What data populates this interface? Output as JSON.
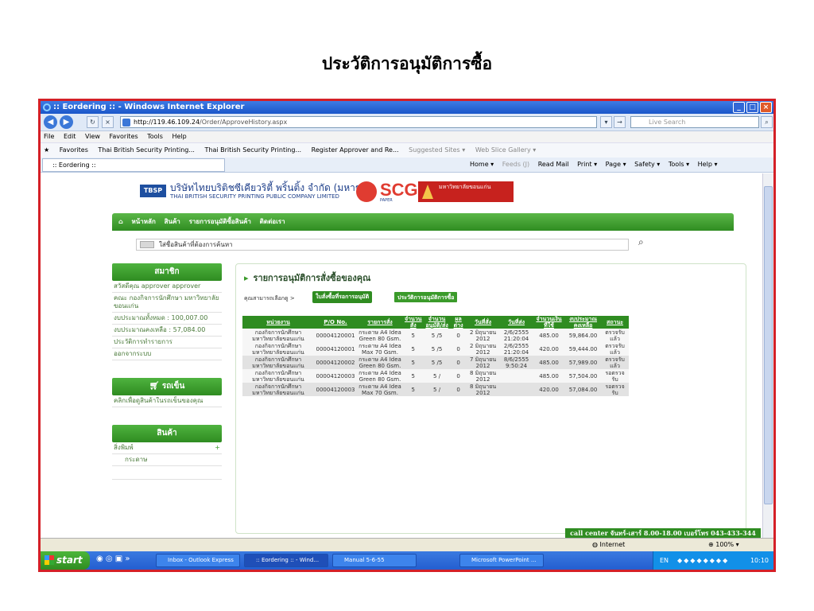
{
  "slide": {
    "title": "ประวัติการอนุมัติการซื้อ"
  },
  "window": {
    "title": ":: Eordering :: - Windows Internet Explorer"
  },
  "address": {
    "url_host": "http://119.46.109.24",
    "url_path": "/Order/ApproveHistory.aspx",
    "search_placeholder": "Live Search"
  },
  "menu": [
    "File",
    "Edit",
    "View",
    "Favorites",
    "Tools",
    "Help"
  ],
  "favorites": {
    "label": "Favorites",
    "items": [
      "Thai British Security Printing...",
      "Thai British Security Printing...",
      "Register Approver and Re...",
      "Suggested Sites ▾",
      "Web Slice Gallery ▾"
    ]
  },
  "tab": {
    "label": ":: Eordering ::"
  },
  "commands": {
    "home": "Home ▾",
    "feeds": "Feeds (J)",
    "mail": "Read Mail",
    "print": "Print ▾",
    "page": "Page ▾",
    "safety": "Safety ▾",
    "tools": "Tools ▾",
    "help": "Help ▾"
  },
  "header": {
    "logo": "TBSP",
    "company_th": "บริษัทไทยบริติชซีเคียวริตี้ พริ้นติ้ง จำกัด (มหาชน)",
    "company_en": "THAI BRITISH SECURITY PRINTING PUBLIC COMPANY LIMITED",
    "scg": "SCG",
    "scg_sub": "PAPER",
    "university": "มหาวิทยาลัยขอนแก่น"
  },
  "nav": [
    "หน้าหลัก",
    "สินค้า",
    "รายการอนุมัติซื้อสินค้า",
    "ติดต่อเรา"
  ],
  "search": {
    "placeholder": "ใส่ชื่อสินค้าที่ต้องการค้นหา"
  },
  "sidebar": {
    "member_title": "สมาชิก",
    "member_items": [
      "สวัสดีคุณ approver approver",
      "คณะ กองกิจการนักศึกษา มหาวิทยาลัยขอนแก่น",
      "งบประมาณทั้งหมด : 100,007.00",
      "งบประมาณคงเหลือ : 57,084.00",
      "ประวัติการทำรายการ",
      "ออกจากระบบ"
    ],
    "cart_title": "รถเข็น",
    "cart_items": [
      "คลิกเพื่อดูสินค้าในรถเข็นของคุณ"
    ],
    "product_title": "สินค้า",
    "product_items": [
      "สิ่งพิมพ์",
      "กระดาษ"
    ]
  },
  "panel": {
    "title": "รายการอนุมัติการสั่งซื้อของคุณ",
    "pick_label": "คุณสามารถเลือกดู >",
    "btn_pending": "ใบสั่งซื้อที่รอการอนุมัติ",
    "btn_history": "ประวัติการอนุมัติการซื้อ"
  },
  "table": {
    "headers": [
      "หน่วยงาน",
      "P/O No.",
      "รายการสั่ง",
      "จำนวนสั่ง",
      "จำนวนอนุมัติ/ส่ง",
      "ผลต่าง",
      "วันที่สั่ง",
      "วันที่ส่ง",
      "จำนวนเงินที่ใช้",
      "งบประมาณคงเหลือ",
      "สถานะ"
    ],
    "rows": [
      [
        "กองกิจการนักศึกษา มหาวิทยาลัยขอนแก่น",
        "00004120001",
        "กระดาษ A4 Idea Green 80 Gsm.",
        "5",
        "5 /5",
        "0",
        "2 มิถุนายน 2012",
        "2/6/2555 21:20:04",
        "485.00",
        "59,864.00",
        "ตรวจรับแล้ว"
      ],
      [
        "กองกิจการนักศึกษา มหาวิทยาลัยขอนแก่น",
        "00004120001",
        "กระดาษ A4 Idea Max 70 Gsm.",
        "5",
        "5 /5",
        "0",
        "2 มิถุนายน 2012",
        "2/6/2555 21:20:04",
        "420.00",
        "59,444.00",
        "ตรวจรับแล้ว"
      ],
      [
        "กองกิจการนักศึกษา มหาวิทยาลัยขอนแก่น",
        "00004120002",
        "กระดาษ A4 Idea Green 80 Gsm.",
        "5",
        "5 /5",
        "0",
        "7 มิถุนายน 2012",
        "8/6/2555 9:50:24",
        "485.00",
        "57,989.00",
        "ตรวจรับแล้ว"
      ],
      [
        "กองกิจการนักศึกษา มหาวิทยาลัยขอนแก่น",
        "00004120003",
        "กระดาษ A4 Idea Green 80 Gsm.",
        "5",
        "5 /",
        "0",
        "8 มิถุนายน 2012",
        "",
        "485.00",
        "57,504.00",
        "รอตรวจรับ"
      ],
      [
        "กองกิจการนักศึกษา มหาวิทยาลัยขอนแก่น",
        "00004120003",
        "กระดาษ A4 Idea Max 70 Gsm.",
        "5",
        "5 /",
        "0",
        "8 มิถุนายน 2012",
        "",
        "420.00",
        "57,084.00",
        "รอตรวจรับ"
      ]
    ]
  },
  "footer": {
    "call_center": "call center จันทร์-เสาร์ 8.00-18.00 เบอร์โทร 043-433-344"
  },
  "status": {
    "zone": "Internet",
    "zoom": "100%"
  },
  "taskbar": {
    "start": "start",
    "tasks": [
      "Inbox - Outlook Express",
      ":: Eordering :: - Wind...",
      "Manual 5-6-55",
      "Microsoft PowerPoint ..."
    ],
    "lang": "EN",
    "clock": "10:10"
  }
}
